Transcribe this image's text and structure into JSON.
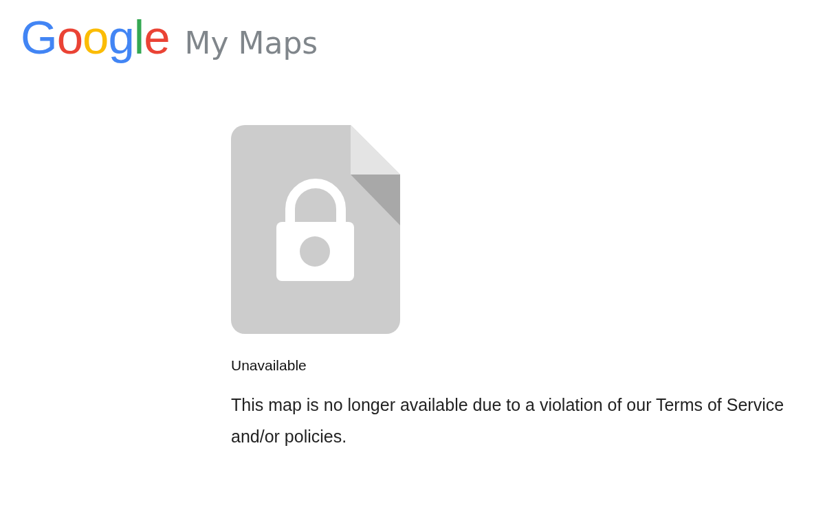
{
  "header": {
    "logo": "Google",
    "product": "My Maps"
  },
  "message": {
    "title": "Unavailable",
    "body": "This map is no longer available due to a violation of our Terms of Service and/or policies."
  }
}
